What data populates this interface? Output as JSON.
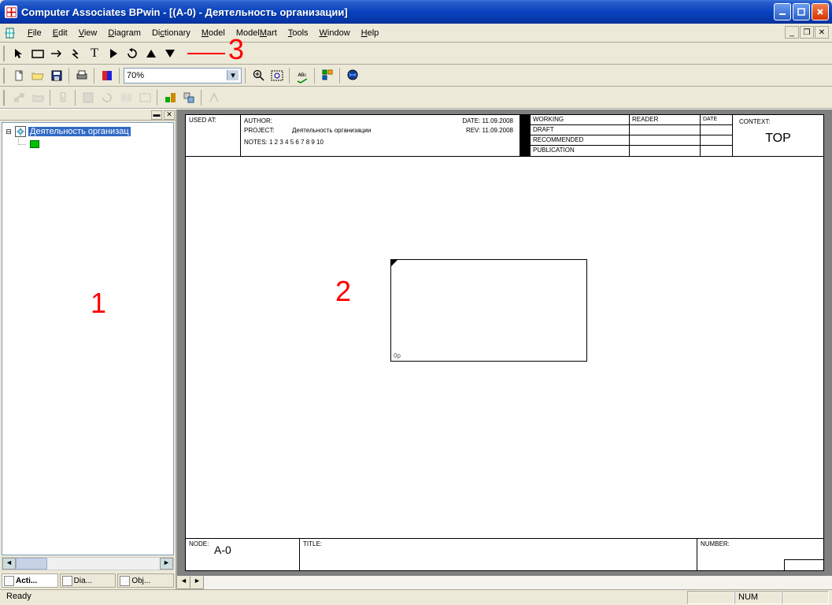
{
  "title": "Computer Associates BPwin - [(A-0)  - Деятельность организации]",
  "menu": {
    "file": "File",
    "edit": "Edit",
    "view": "View",
    "diagram": "Diagram",
    "dictionary": "Dictionary",
    "model": "Model",
    "modelmart": "ModelMart",
    "tools": "Tools",
    "window": "Window",
    "help": "Help"
  },
  "toolbar": {
    "zoom_value": "70%"
  },
  "tree": {
    "root_label": "Деятельность организац"
  },
  "bottom_tabs": {
    "activities": "Acti...",
    "diagrams": "Dia...",
    "objects": "Obj..."
  },
  "sheet": {
    "used_at": "USED AT:",
    "author_label": "AUTHOR:",
    "project_label": "PROJECT:",
    "project_value": "Деятельность организации",
    "date_label": "DATE:",
    "date_value": "11.09.2008",
    "rev_label": "REV:",
    "rev_value": "11.09.2008",
    "notes": "NOTES:  1  2  3  4  5  6  7  8  9  10",
    "status": {
      "working": "WORKING",
      "reader": "READER",
      "date": "DATE",
      "draft": "DRAFT",
      "recommended": "RECOMMENDED",
      "publication": "PUBLICATION"
    },
    "context_label": "CONTEXT:",
    "context_value": "TOP",
    "activity_id": "0р",
    "node_label": "NODE:",
    "node_value": "A-0",
    "title_label": "TITLE:",
    "number_label": "NUMBER:"
  },
  "statusbar": {
    "ready": "Ready",
    "num": "NUM"
  },
  "annotations": {
    "one": "1",
    "two": "2",
    "three": "3"
  }
}
